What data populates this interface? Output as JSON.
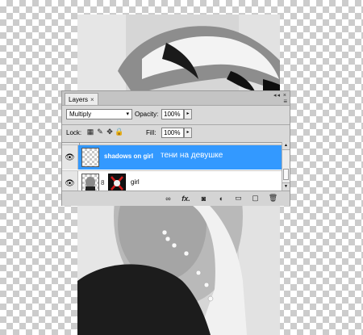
{
  "panel": {
    "tab_label": "Layers",
    "tab_close": "×",
    "collapse_icons": "◂◂ ×",
    "menu_icon": "≡",
    "blend_mode": "Multiply",
    "opacity_label": "Opacity:",
    "opacity_value": "100%",
    "lock_label": "Lock:",
    "fill_label": "Fill:",
    "fill_value": "100%",
    "spin_glyph": "▸",
    "dropdown_glyph": "▾"
  },
  "layers": [
    {
      "name": "shadows on girl",
      "note": "тени на девушке",
      "visible_icon": "eye-icon",
      "selected": true
    },
    {
      "name": "girl",
      "note": "",
      "visible_icon": "eye-icon",
      "selected": false
    }
  ],
  "glyphs": {
    "eye": "👁",
    "chain": "8",
    "lock_transparent": "▦",
    "lock_paint": "✎",
    "lock_move": "✥",
    "lock_all": "🔒",
    "link": "∞",
    "fx": "fx.",
    "mask": "◙",
    "adjust": "◐",
    "folder": "▭",
    "new": "▢",
    "trash": "🗑",
    "scroll_up": "▲",
    "scroll_down": "▼"
  },
  "colors": {
    "selection": "#3399ff",
    "panel_bg": "#d9d9d9"
  }
}
